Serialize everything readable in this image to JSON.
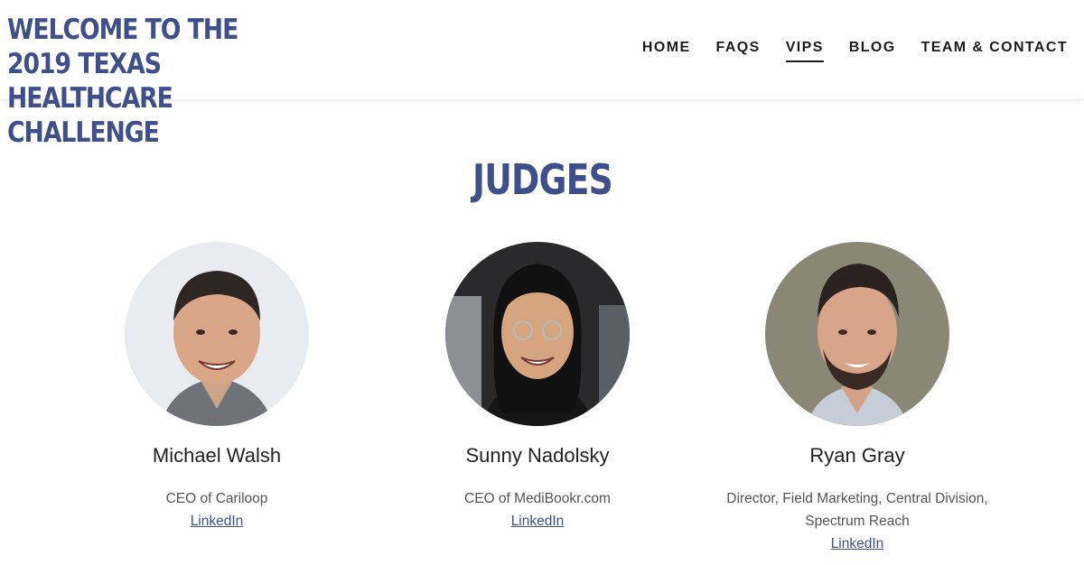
{
  "header": {
    "title": "WELCOME TO THE 2019 TEXAS HEALTHCARE CHALLENGE",
    "nav": [
      {
        "label": "HOME",
        "active": false
      },
      {
        "label": "FAQS",
        "active": false
      },
      {
        "label": "VIPS",
        "active": true
      },
      {
        "label": "BLOG",
        "active": false
      },
      {
        "label": "TEAM & CONTACT",
        "active": false
      }
    ]
  },
  "section": {
    "title": "JUDGES"
  },
  "judges": [
    {
      "name": "Michael Walsh",
      "role": "CEO of Cariloop",
      "link": "LinkedIn"
    },
    {
      "name": "Sunny Nadolsky",
      "role": "CEO of MediBookr.com",
      "link": "LinkedIn"
    },
    {
      "name": "Ryan Gray",
      "role": "Director, Field Marketing, Central Division, Spectrum Reach",
      "link": "LinkedIn"
    }
  ],
  "colors": {
    "accent": "#3f4f8c",
    "text": "#222222"
  }
}
